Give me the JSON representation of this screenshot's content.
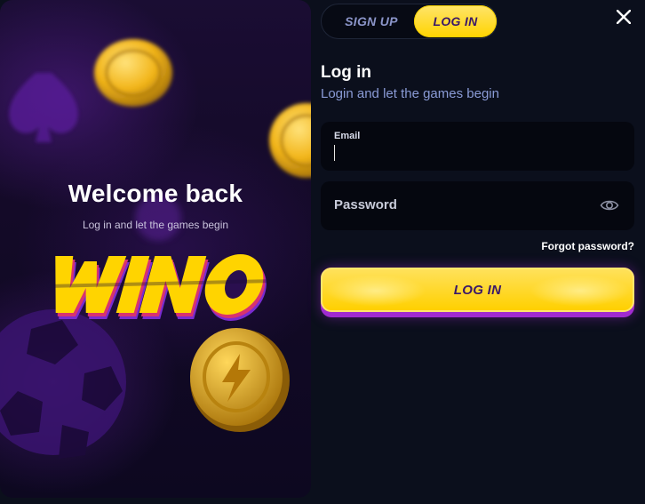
{
  "promo": {
    "title": "Welcome back",
    "subtitle": "Log in and let the games begin",
    "logo_text": "WINO",
    "logo_colors": {
      "fill": "#ffd400",
      "shadow": "#d8336f",
      "edge": "#7a2bd0"
    }
  },
  "tabs": {
    "signup_label": "SIGN UP",
    "login_label": "LOG IN",
    "active": "login"
  },
  "form": {
    "title": "Log in",
    "subtitle": "Login and let the games begin",
    "email_label": "Email",
    "email_value": "",
    "password_label": "Password",
    "forgot_label": "Forgot password?",
    "submit_label": "LOG IN"
  },
  "icons": {
    "close": "close-icon",
    "eye": "eye-icon"
  },
  "colors": {
    "background": "#0b0f1c",
    "accent": "#ffd400",
    "accent_text": "#3a1868",
    "purple": "#a02bd0",
    "subtitle_blue": "#8a9bd6"
  }
}
